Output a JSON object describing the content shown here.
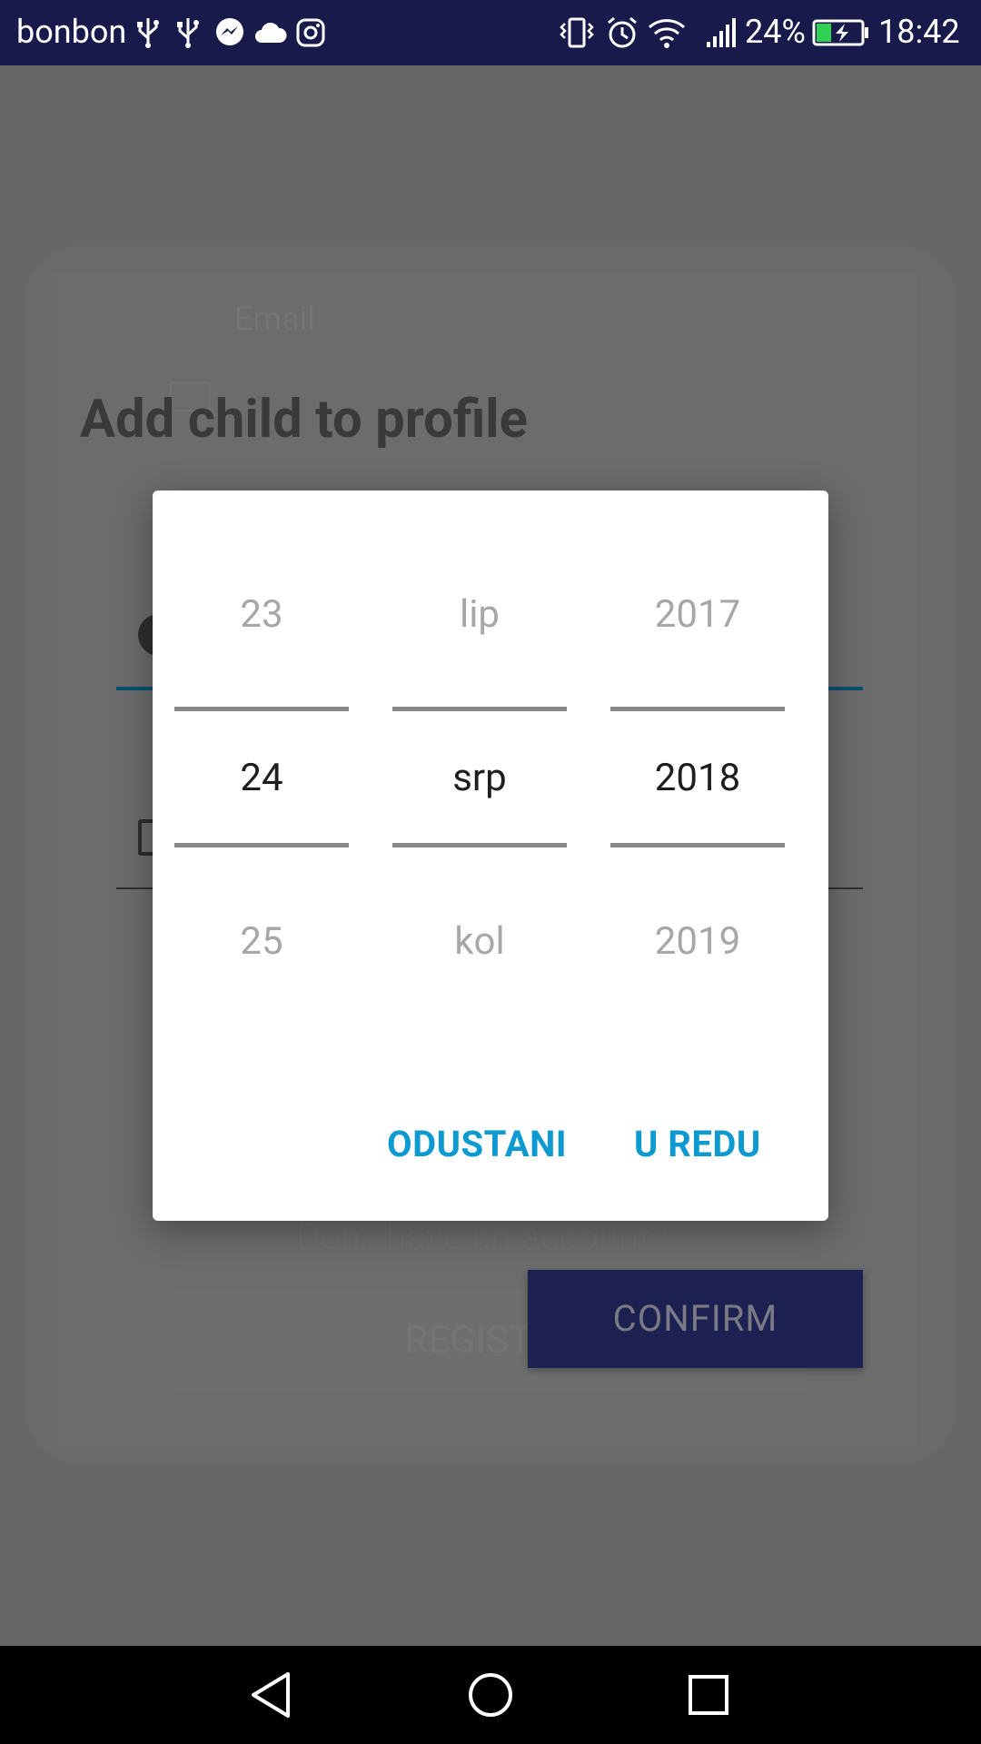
{
  "status_bar": {
    "carrier": "bonbon",
    "battery_percent": "24%",
    "time": "18:42",
    "icons": [
      "usb-icon",
      "usb-icon",
      "messenger-icon",
      "cloud-icon",
      "instagram-icon",
      "vibrate-icon",
      "alarm-icon",
      "wifi-icon",
      "signal-icon",
      "battery-charging-icon"
    ]
  },
  "background": {
    "email_hint": "Email",
    "title": "Add child to profile",
    "account_text": "Don't have an account?",
    "register_label": "REGISTER",
    "confirm_label": "CONFIRM"
  },
  "date_picker": {
    "day": {
      "prev": "23",
      "current": "24",
      "next": "25"
    },
    "month": {
      "prev": "lip",
      "current": "srp",
      "next": "kol"
    },
    "year": {
      "prev": "2017",
      "current": "2018",
      "next": "2019"
    },
    "cancel_label": "ODUSTANI",
    "ok_label": "U REDU"
  },
  "colors": {
    "status_bar": "#171a4a",
    "dialog_button": "#0d9ad1",
    "confirm_button": "#1d2152",
    "accent_line": "#06506e"
  }
}
